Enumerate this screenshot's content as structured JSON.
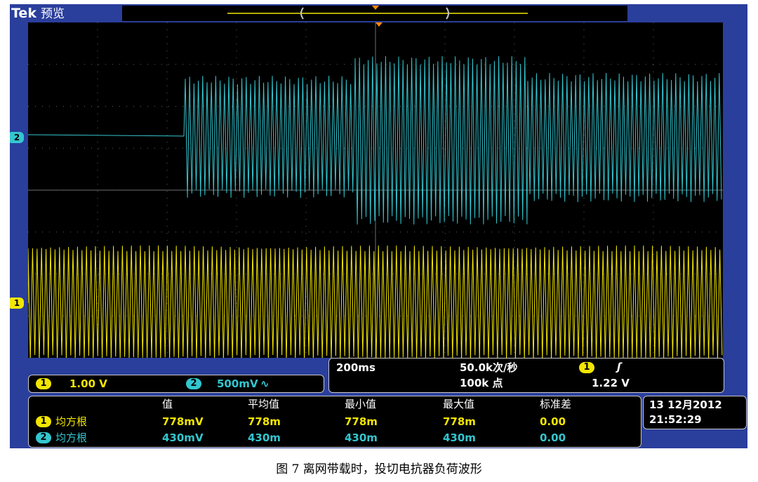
{
  "header": {
    "brand": "Tek",
    "mode": "预览"
  },
  "markers": {
    "ch1": "1",
    "ch2": "2"
  },
  "channels": [
    {
      "id": "1",
      "scale": "1.00 V",
      "color": "#f2e600"
    },
    {
      "id": "2",
      "scale": "500mV",
      "coupling_icon": "∿",
      "color": "#33c6d0"
    }
  ],
  "horizontal": {
    "timebase": "200ms",
    "sample_rate": "50.0k次/秒",
    "record_length": "100k 点",
    "trigger_channel": "1",
    "trigger_slope_icon": "rising-edge-icon",
    "trigger_slope_glyph": "ʃ",
    "trigger_level": "1.22 V"
  },
  "measurements": {
    "headers": [
      "值",
      "平均值",
      "最小值",
      "最大值",
      "标准差"
    ],
    "rows": [
      {
        "channel": "1",
        "type": "均方根",
        "values": [
          "778mV",
          "778m",
          "778m",
          "778m",
          "0.00"
        ]
      },
      {
        "channel": "2",
        "type": "均方根",
        "values": [
          "430mV",
          "430m",
          "430m",
          "430m",
          "0.00"
        ]
      }
    ]
  },
  "datetime": {
    "date": "13 12月2012",
    "time": "21:52:29"
  },
  "caption": "图 7    离网带载时，投切电抗器负荷波形",
  "colors": {
    "frame": "#2a3e9c",
    "ch1": "#f2e600",
    "ch2": "#33c6d0",
    "grid": "#7a7a7a"
  }
}
